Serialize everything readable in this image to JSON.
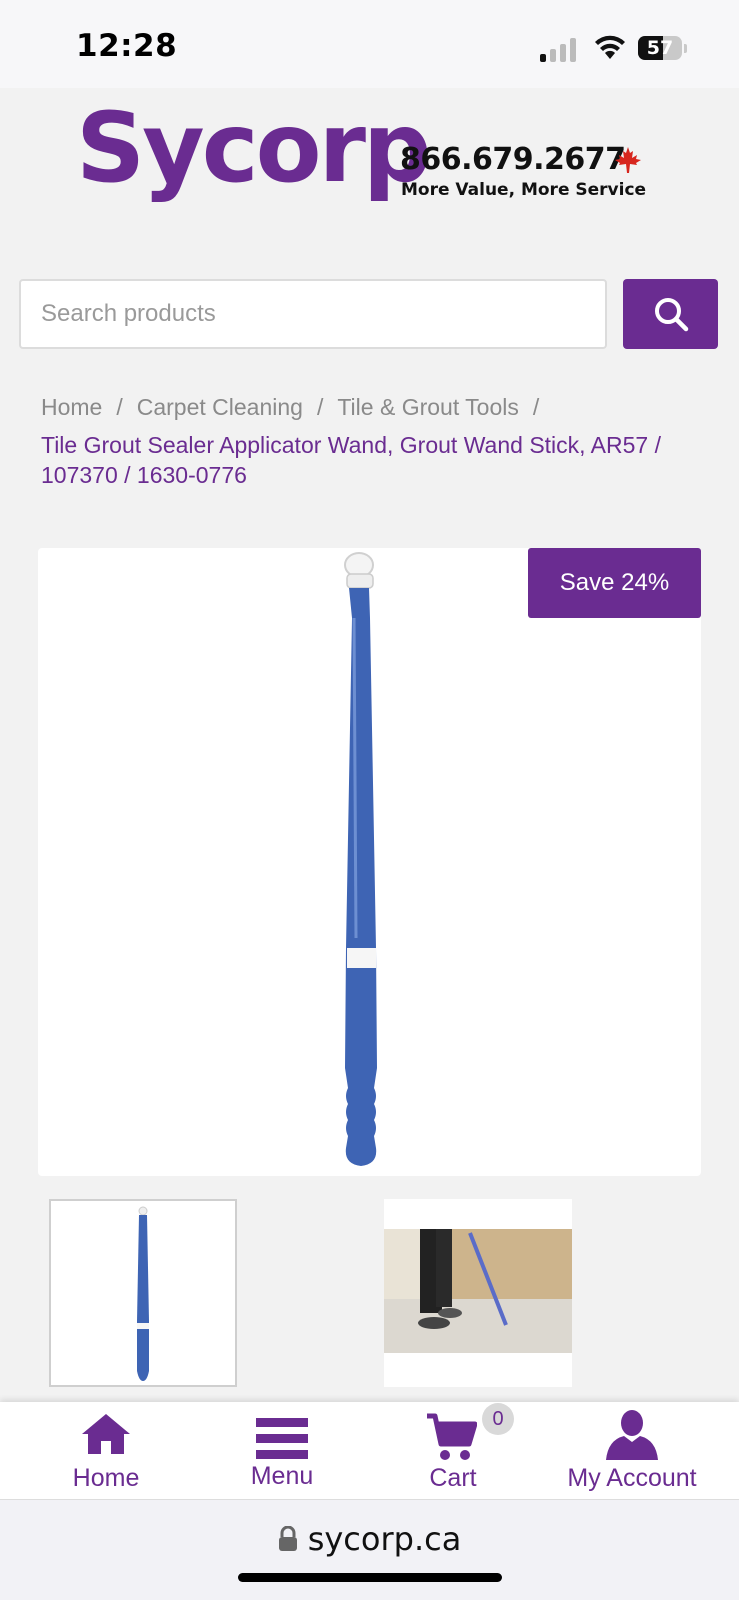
{
  "status": {
    "time": "12:28",
    "battery": "57",
    "battery_level": 0.57
  },
  "brand": {
    "logo_text": "Sycorp",
    "phone": "866.679.2677",
    "tagline": "More Value, More Service",
    "accent_color": "#6a2c91",
    "flag_color": "#d7261e"
  },
  "search": {
    "placeholder": "Search products"
  },
  "breadcrumb": {
    "items": [
      "Home",
      "Carpet Cleaning",
      "Tile & Grout Tools"
    ],
    "separator": "/",
    "current": "Tile Grout Sealer Applicator Wand, Grout Wand Stick, AR57 / 107370 / 1630-0776"
  },
  "product": {
    "badge": "Save 24%",
    "wand_color": "#3e64b4"
  },
  "bottom_nav": {
    "home": "Home",
    "menu": "Menu",
    "cart": "Cart",
    "cart_count": "0",
    "account": "My Account"
  },
  "browser": {
    "url": "sycorp.ca"
  }
}
